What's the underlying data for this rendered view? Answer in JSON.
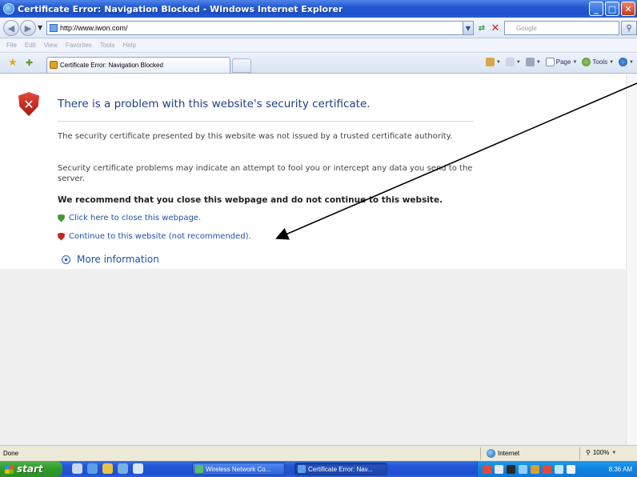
{
  "window": {
    "title": "Certificate Error: Navigation Blocked - Windows Internet Explorer",
    "controls": [
      "minimize",
      "maximize",
      "close"
    ]
  },
  "address_bar": {
    "url": "http://www.iwon.com/",
    "search_placeholder": "Google"
  },
  "menu": {
    "items": [
      "File",
      "Edit",
      "View",
      "Favorites",
      "Tools",
      "Help"
    ]
  },
  "tabs": {
    "active_label": "Certificate Error: Navigation Blocked"
  },
  "commands": {
    "page_label": "Page",
    "tools_label": "Tools"
  },
  "content": {
    "heading": "There is a problem with this website's security certificate.",
    "para1": "The security certificate presented by this website was not issued by a trusted certificate authority.",
    "para2": "Security certificate problems may indicate an attempt to fool you or intercept any data you send to the server.",
    "recommend": "We recommend that you close this webpage and do not continue to this website.",
    "link_close": "Click here to close this webpage.",
    "link_continue": "Continue to this website (not recommended).",
    "more_info": "More information"
  },
  "status": {
    "text": "Done",
    "zone": "Internet",
    "zoom": "100%"
  },
  "taskbar": {
    "start_label": "start",
    "tasks": [
      "Wireless Network Co...",
      "Certificate Error: Nav..."
    ],
    "clock": "8:36 AM"
  },
  "colors": {
    "heading_blue": "#1f3e8a",
    "link_blue": "#1f4fa8",
    "title_bar_blue": "#2458d1",
    "start_green": "#2f9a2a"
  }
}
